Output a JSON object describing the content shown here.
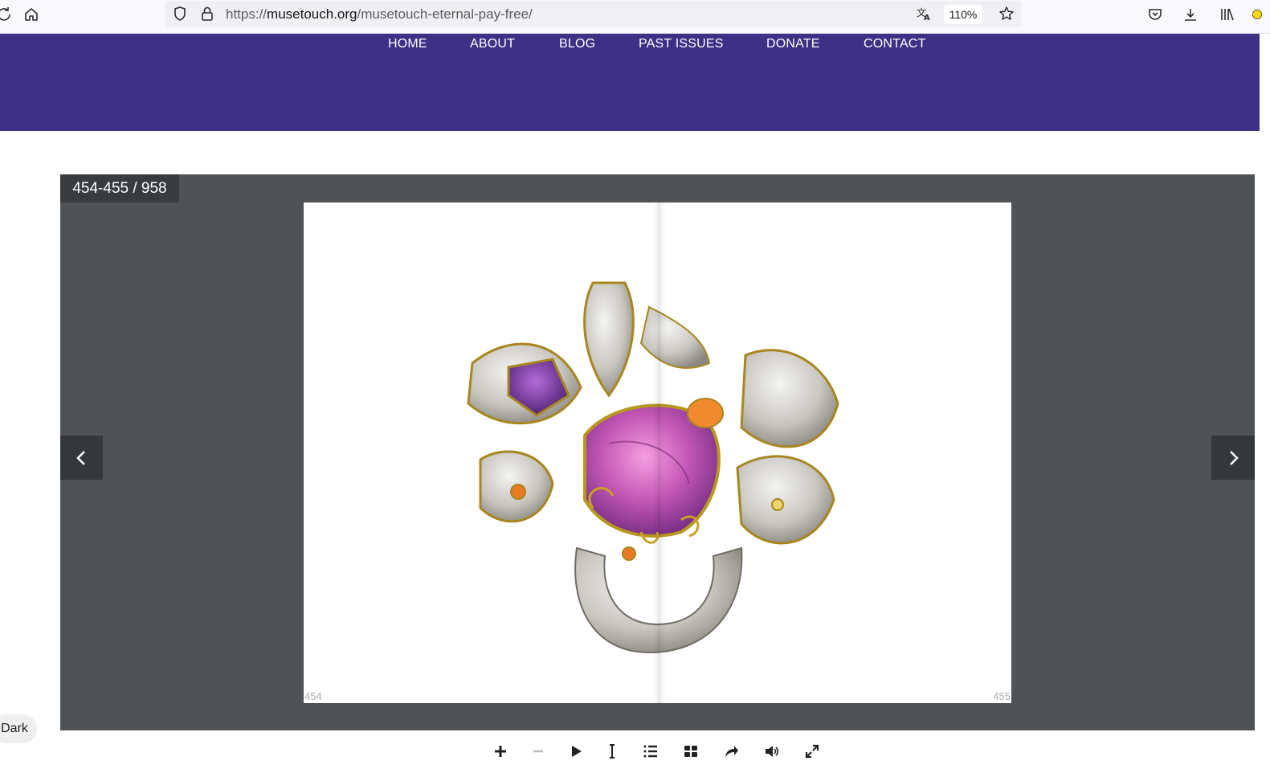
{
  "browser": {
    "url_prefix": "https://",
    "url_domain": "musetouch.org",
    "url_path": "/musetouch-eternal-pay-free/",
    "zoom": "110%"
  },
  "nav": {
    "items": [
      "HOME",
      "ABOUT",
      "BLOG",
      "PAST ISSUES",
      "DONATE",
      "CONTACT"
    ]
  },
  "flipbook": {
    "page_counter": "454-455 / 958",
    "left_page_number": "454",
    "right_page_number": "455"
  },
  "theme_toggle": {
    "label": "Dark"
  },
  "colors": {
    "nav_background": "#3e3085",
    "viewer_background": "#4f5356"
  }
}
